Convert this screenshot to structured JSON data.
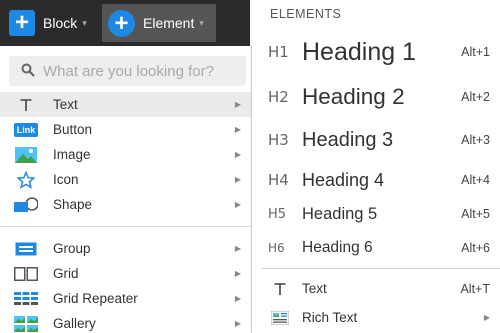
{
  "toolbar": {
    "block_label": "Block",
    "element_label": "Element",
    "plus_glyph": "+",
    "caret_glyph": "▾"
  },
  "search": {
    "placeholder": "What are you looking for?"
  },
  "left_menu": {
    "items": [
      {
        "label": "Text",
        "icon": "text-T-icon"
      },
      {
        "label": "Button",
        "icon": "link-button-icon",
        "badge": "Link"
      },
      {
        "label": "Image",
        "icon": "image-icon"
      },
      {
        "label": "Icon",
        "icon": "star-icon"
      },
      {
        "label": "Shape",
        "icon": "shape-icon"
      },
      {
        "label": "Group",
        "icon": "group-icon"
      },
      {
        "label": "Grid",
        "icon": "grid-icon"
      },
      {
        "label": "Grid Repeater",
        "icon": "grid-repeater-icon"
      },
      {
        "label": "Gallery",
        "icon": "gallery-icon"
      }
    ],
    "arrow_glyph": "▶"
  },
  "elements_panel": {
    "header": "ELEMENTS",
    "headings": [
      {
        "tag": "H1",
        "label": "Heading 1",
        "shortcut": "Alt+1"
      },
      {
        "tag": "H2",
        "label": "Heading 2",
        "shortcut": "Alt+2"
      },
      {
        "tag": "H3",
        "label": "Heading 3",
        "shortcut": "Alt+3"
      },
      {
        "tag": "H4",
        "label": "Heading 4",
        "shortcut": "Alt+4"
      },
      {
        "tag": "H5",
        "label": "Heading 5",
        "shortcut": "Alt+5"
      },
      {
        "tag": "H6",
        "label": "Heading 6",
        "shortcut": "Alt+6"
      }
    ],
    "text_item": {
      "label": "Text",
      "shortcut": "Alt+T"
    },
    "rich_text_item": {
      "label": "Rich Text"
    }
  },
  "colors": {
    "accent": "#1e88e5",
    "toolbar_bg": "#2b2b2b",
    "active_row": "#eaeaea"
  }
}
